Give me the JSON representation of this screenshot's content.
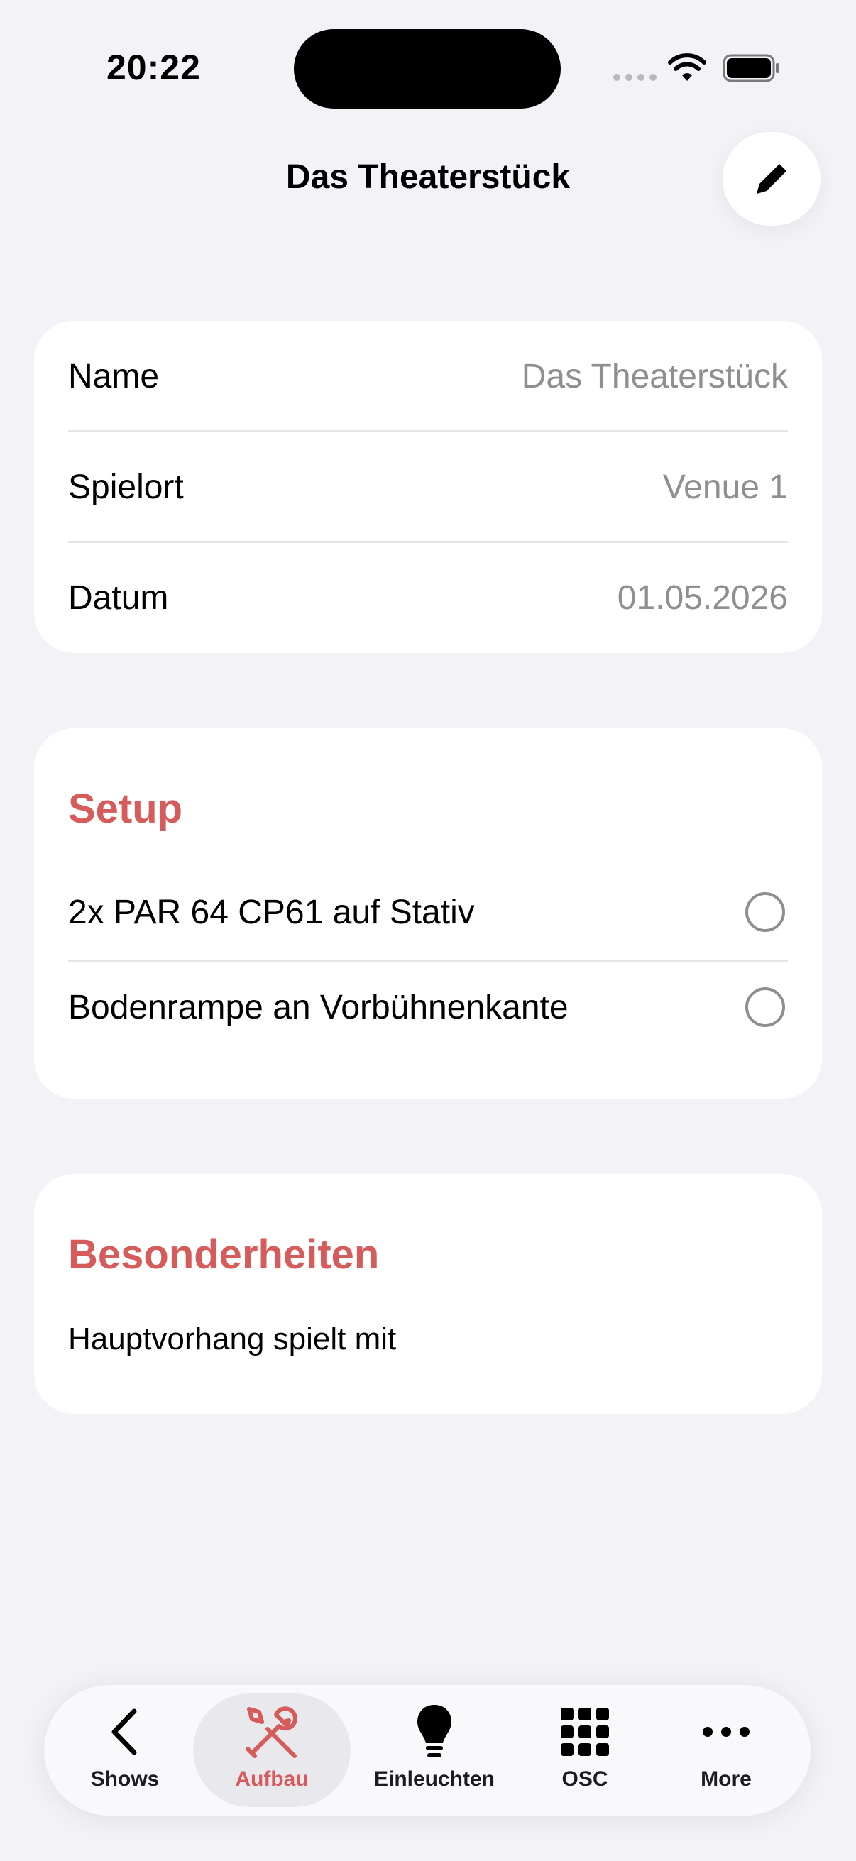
{
  "status_bar": {
    "time": "20:22"
  },
  "nav": {
    "title": "Das Theaterstück"
  },
  "details": {
    "rows": [
      {
        "label": "Name",
        "value": "Das Theaterstück"
      },
      {
        "label": "Spielort",
        "value": "Venue 1"
      },
      {
        "label": "Datum",
        "value": "01.05.2026"
      }
    ]
  },
  "setup": {
    "title": "Setup",
    "items": [
      {
        "label": "2x PAR 64 CP61 auf Stativ",
        "checked": false
      },
      {
        "label": "Bodenrampe an Vorbühnenkante",
        "checked": false
      }
    ]
  },
  "notes": {
    "title": "Besonderheiten",
    "text": "Hauptvorhang spielt mit"
  },
  "tabs": [
    {
      "label": "Shows",
      "icon": "chevron-left-icon",
      "active": false
    },
    {
      "label": "Aufbau",
      "icon": "tools-icon",
      "active": true
    },
    {
      "label": "Einleuchten",
      "icon": "lightbulb-icon",
      "active": false
    },
    {
      "label": "OSC",
      "icon": "grid-icon",
      "active": false
    },
    {
      "label": "More",
      "icon": "ellipsis-icon",
      "active": false
    }
  ],
  "colors": {
    "accent": "#D65B5B",
    "background": "#F2F2F7",
    "secondary_text": "#8E8E93"
  }
}
